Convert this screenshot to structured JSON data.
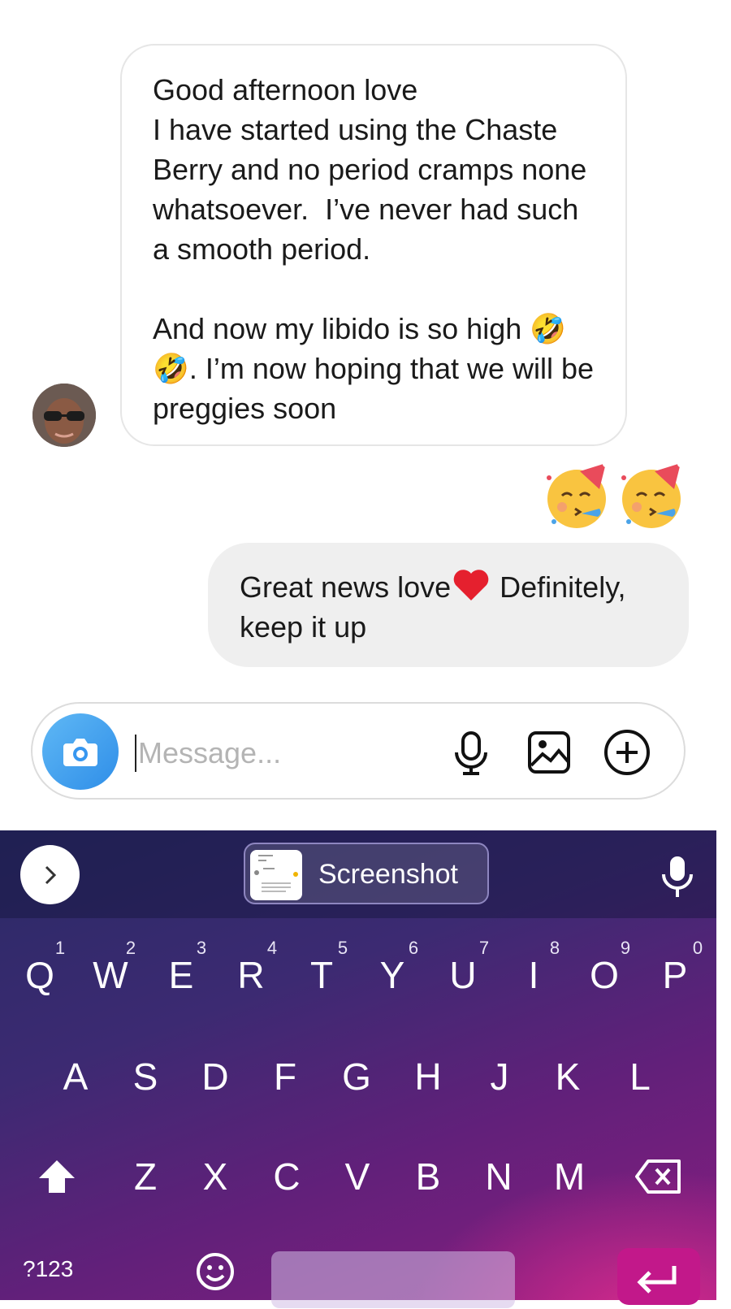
{
  "chat": {
    "incoming_message": "Good afternoon love\nI have started using the Chaste Berry and no period cramps none whatsoever.  I’ve never had such a smooth period.\n\nAnd now my libido is so high 🤣🤣. I’m now hoping that we will be preggies soon",
    "reactions": [
      "partying-face-emoji",
      "partying-face-emoji"
    ],
    "outgoing_message": {
      "before": "Great news love",
      "after": " Definitely, keep it up"
    }
  },
  "composer": {
    "placeholder": "Message..."
  },
  "keyboard": {
    "suggestion_chip": "Screenshot",
    "row1": [
      {
        "key": "Q",
        "hint": "1"
      },
      {
        "key": "W",
        "hint": "2"
      },
      {
        "key": "E",
        "hint": "3"
      },
      {
        "key": "R",
        "hint": "4"
      },
      {
        "key": "T",
        "hint": "5"
      },
      {
        "key": "Y",
        "hint": "6"
      },
      {
        "key": "U",
        "hint": "7"
      },
      {
        "key": "I",
        "hint": "8"
      },
      {
        "key": "O",
        "hint": "9"
      },
      {
        "key": "P",
        "hint": "0"
      }
    ],
    "row2": [
      "A",
      "S",
      "D",
      "F",
      "G",
      "H",
      "J",
      "K",
      "L"
    ],
    "row3": [
      "Z",
      "X",
      "C",
      "V",
      "B",
      "N",
      "M"
    ],
    "symbols_key": "?123",
    "colors": {
      "accent": "#c2188a",
      "composer_camera": "#3797f0"
    }
  }
}
